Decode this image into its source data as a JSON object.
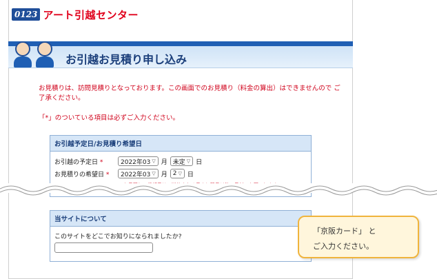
{
  "brand": {
    "badge": "0123",
    "name": "アート引越センター"
  },
  "page": {
    "title": "お引越お見積り申し込み"
  },
  "notice": "お見積りは、訪問見積りとなっております。この画面でのお見積り（料金の算出）はできませんので ご了承ください。",
  "required_note": {
    "mark": "「*」",
    "text": "のついている項目は必ずご入力ください。"
  },
  "section1": {
    "heading": "お引越予定日/お見積り希望日",
    "move_date": {
      "label": "お引越の予定日",
      "required": "*",
      "month": "2022年03",
      "unit_month": "月",
      "day": "未定",
      "unit_day": "日"
    },
    "estimate_date": {
      "label": "お見積りの希望日",
      "required": "*",
      "month": "2022年03",
      "unit_month": "月",
      "day": "2",
      "unit_day": "日"
    },
    "note": "※お見積りの希望日は、送信される日より翌日以後の日付でお願いします。"
  },
  "section2": {
    "heading": "当サイトについて",
    "question": "このサイトをどこでお知りになられましたか?",
    "input_value": ""
  },
  "callout": {
    "line1": "「京阪カード」 と",
    "line2": "ご入力ください。"
  }
}
